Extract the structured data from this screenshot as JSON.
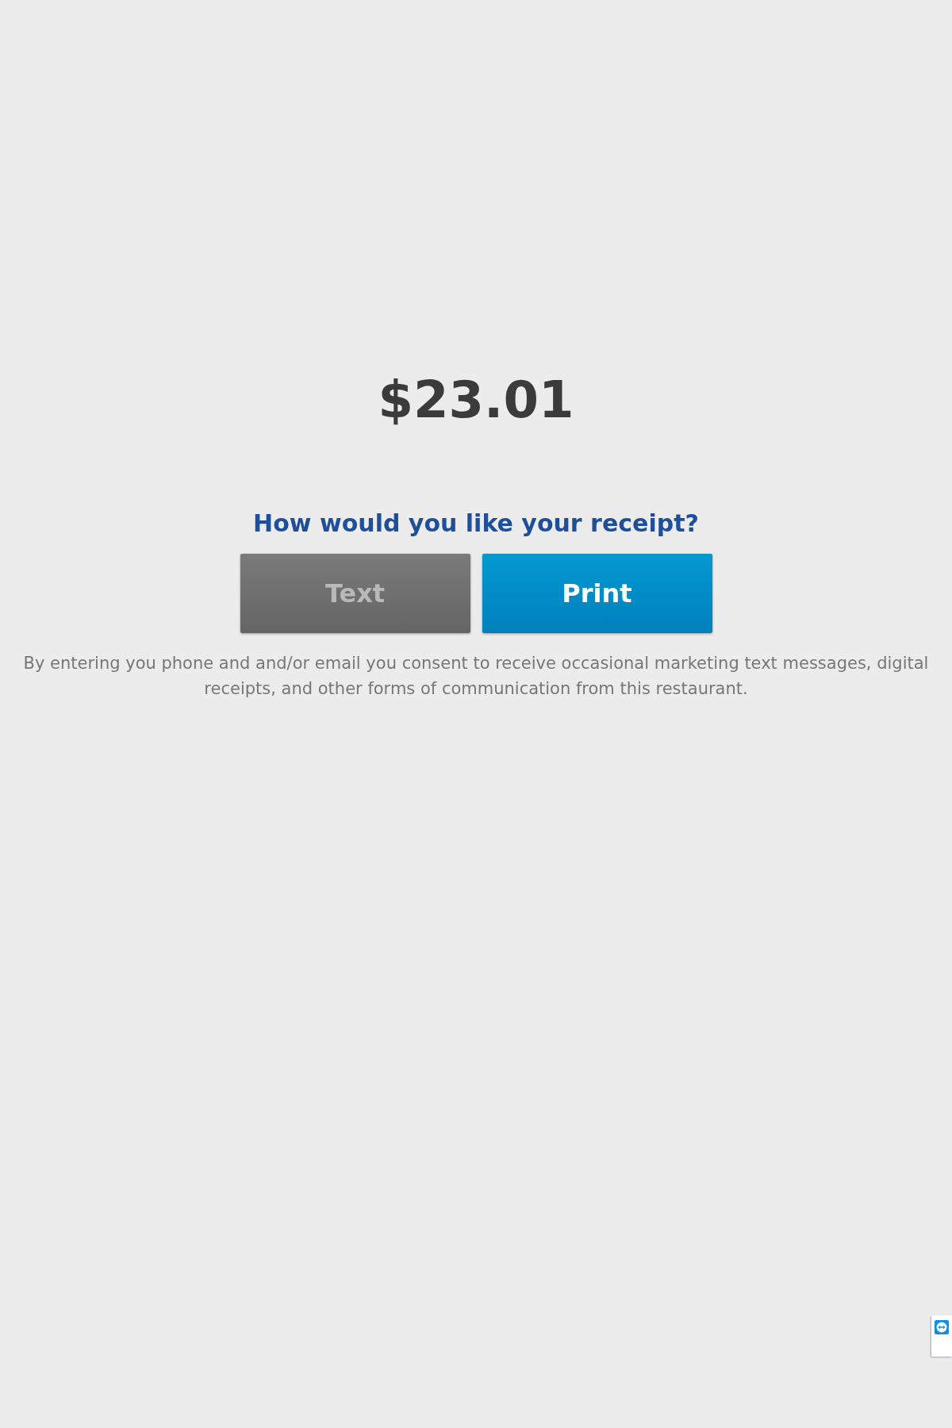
{
  "amount": "$23.01",
  "question": "How would you like your receipt?",
  "buttons": [
    {
      "label": "Text",
      "kind": "secondary",
      "disabled": true
    },
    {
      "label": "Print",
      "kind": "primary",
      "disabled": false
    }
  ],
  "disclaimer": "By entering you phone and and/or email you consent to receive occasional marketing text messages, digital receipts, and other forms of communication from this restaurant."
}
